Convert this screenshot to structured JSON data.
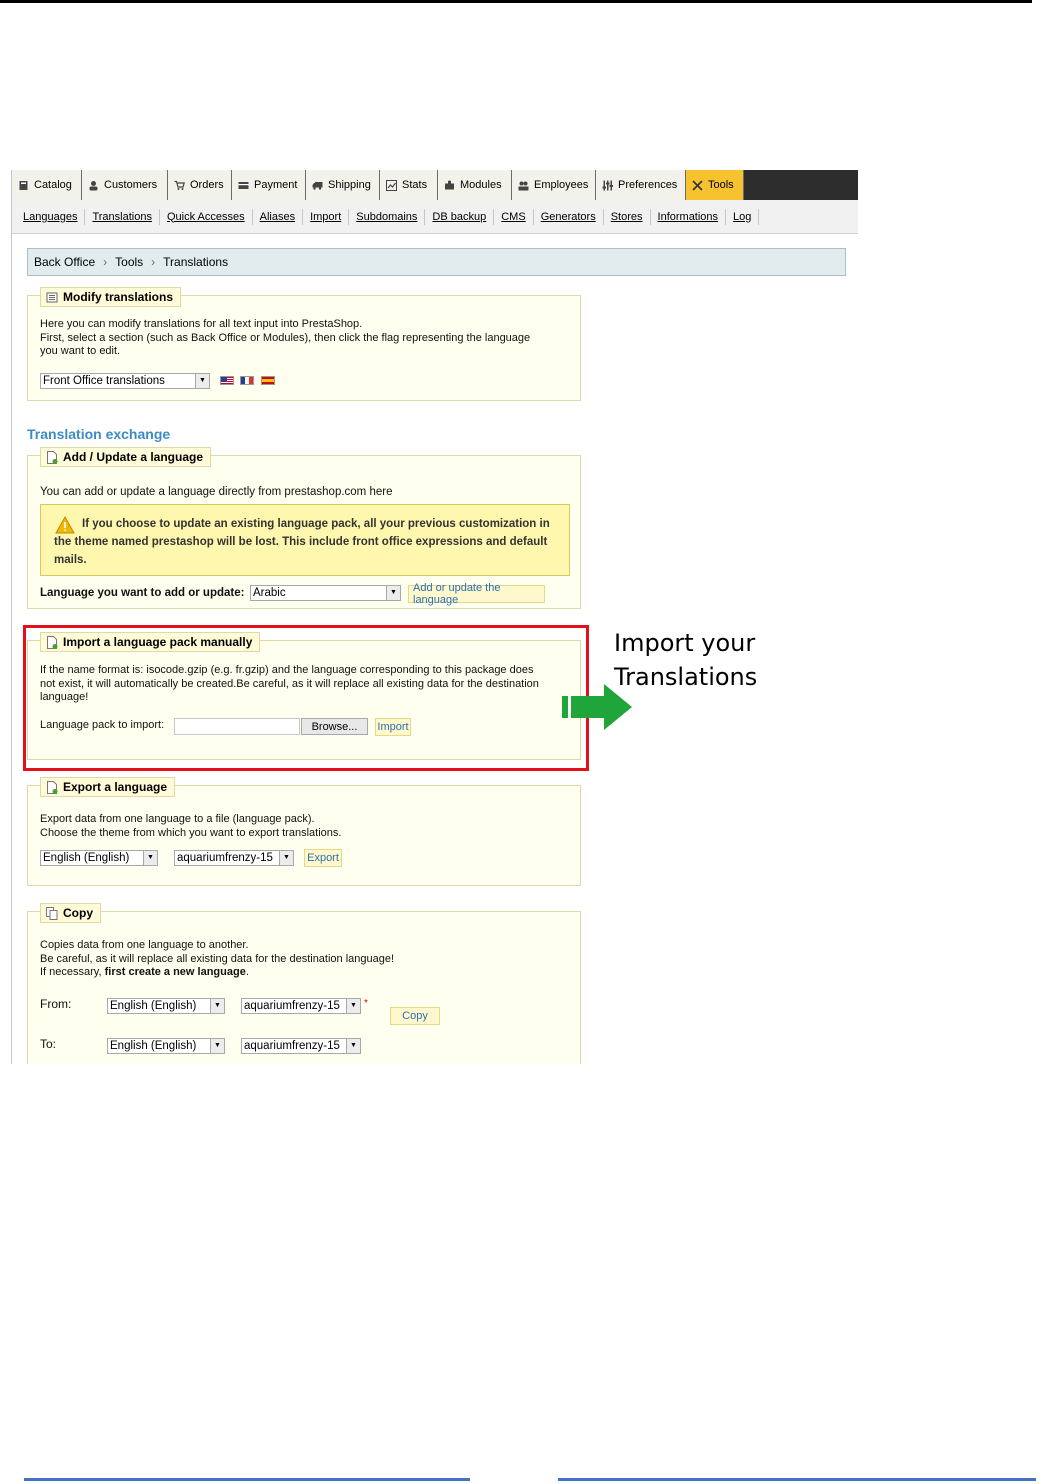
{
  "tabs": [
    {
      "label": "Catalog",
      "icon": "book-icon"
    },
    {
      "label": "Customers",
      "icon": "person-icon"
    },
    {
      "label": "Orders",
      "icon": "cart-icon"
    },
    {
      "label": "Payment",
      "icon": "card-icon"
    },
    {
      "label": "Shipping",
      "icon": "truck-icon"
    },
    {
      "label": "Stats",
      "icon": "chart-icon"
    },
    {
      "label": "Modules",
      "icon": "puzzle-icon"
    },
    {
      "label": "Employees",
      "icon": "people-icon"
    },
    {
      "label": "Preferences",
      "icon": "sliders-icon"
    },
    {
      "label": "Tools",
      "icon": "tools-icon",
      "active": true
    }
  ],
  "subnav": [
    "Languages",
    "Translations",
    "Quick Accesses",
    "Aliases",
    "Import",
    "Subdomains",
    "DB backup",
    "CMS",
    "Generators",
    "Stores",
    "Informations",
    "Log"
  ],
  "breadcrumb": [
    "Back Office",
    "Tools",
    "Translations"
  ],
  "modify": {
    "legend": "Modify translations",
    "line1": "Here you can modify translations for all text input into PrestaShop.",
    "line2": "First, select a section (such as Back Office or Modules), then click the flag representing the language",
    "line3": "you want to edit.",
    "select_value": "Front Office translations",
    "flags": [
      "us-flag-icon",
      "fr-flag-icon",
      "es-flag-icon"
    ]
  },
  "exchange_heading": "Translation exchange",
  "add_update": {
    "legend": "Add / Update a language",
    "intro": "You can add or update a language directly from prestashop.com here",
    "warning": "If you choose to update an existing language pack, all your previous customization in the theme named prestashop will be lost. This include front office expressions and default mails.",
    "label": "Language you want to add or update:",
    "select_value": "Arabic",
    "button": "Add or update the language"
  },
  "import_pack": {
    "legend": "Import a language pack manually",
    "line1": "If the name format is: isocode.gzip (e.g. fr.gzip) and the language corresponding to this package does",
    "line2": "not exist, it will automatically be created.Be careful, as it will replace all existing data for the destination",
    "line3": "language!",
    "label": "Language pack to import:",
    "browse": "Browse...",
    "button": "Import"
  },
  "export": {
    "legend": "Export a language",
    "line1": "Export data from one language to a file (language pack).",
    "line2": "Choose the theme from which you want to export translations.",
    "language": "English (English)",
    "theme": "aquariumfrenzy-15",
    "button": "Export"
  },
  "copy": {
    "legend": "Copy",
    "line1": "Copies data from one language to another.",
    "line2": "Be careful, as it will replace all existing data for the destination language!",
    "line3_prefix": "If necessary, ",
    "line3_bold": "first create a new language",
    "line3_suffix": ".",
    "from_label": "From:",
    "to_label": "To:",
    "from_language": "English (English)",
    "from_theme": "aquariumfrenzy-15",
    "to_language": "English (English)",
    "to_theme": "aquariumfrenzy-15",
    "required_mark": "*",
    "button": "Copy"
  },
  "annotation": {
    "line1": "Import your",
    "line2": "Translations",
    "arrow_color": "#1fa53a",
    "box_color": "#e3101b"
  }
}
